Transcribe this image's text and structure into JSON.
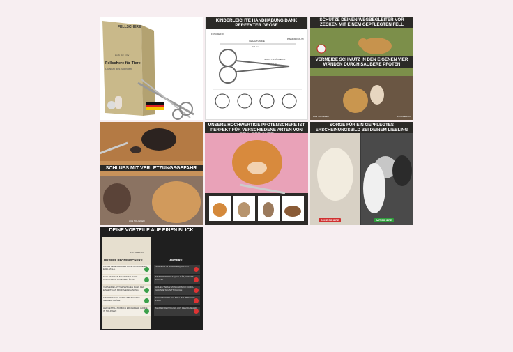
{
  "tile1": {
    "box_title": "FELLSCHERE",
    "brand": "FUTURE FOX",
    "line1": "Fellschere für Tiere",
    "line2": "Qualität aus Solingen"
  },
  "tile2": {
    "title": "KINDERLEICHTE HANDHABUNG DANK PERFEKTER GRÖßE",
    "brand": "FUTURE FOX",
    "length_label": "GESAMTLÄNGE",
    "length_value": "9,6 cm",
    "blade_label": "SCHNITTFLÄCHE CA.",
    "blade_value": "2,5 cm",
    "badge": "PREMIUM QUALITY"
  },
  "tile3": {
    "title": "SCHÜTZE DEINEN WEGBEGLEITER VOR ZECKEN MIT EINEM GEPFLEGTEN FELL",
    "subtitle": "VERMEIDE SCHMUTZ IN DEN EIGENEN VIER WÄNDEN DURCH SAUBERE PFOTEN",
    "footer_left": "AUS SOLINGEN",
    "footer_right": "FUTURE FOX"
  },
  "tile4": {
    "title": "SCHLUSS MIT VERLETZUNGSGEFAHR",
    "footer": "AUS SOLINGEN"
  },
  "tile5": {
    "title": "UNSERE HOCHWERTIGE PFOTENSCHERE IST PERFEKT FÜR VERSCHIEDENE ARTEN VON FELL GEEIGNET"
  },
  "tile6": {
    "title": "SORGE FÜR EIN GEPFLEGTES ERSCHEINUNGSBILD BEI DEINEM LIEBLING",
    "label_left": "OHNE SCHERE",
    "label_right": "MIT SCHERE"
  },
  "tile7": {
    "title": "DEINE VORTEILE AUF EINEN BLICK",
    "ours": "UNSERE PFOTENSCHERE",
    "others": "ANDERE",
    "brand": "FUTURE FOX",
    "ours_rows": [
      "LANGE LEBENSDAUER DANK ROSTFREIEM EDELSTAHL",
      "KEIN VERLETZUNGSRISIKO DANK GEBOGENER SCHNITTFLÄCHE",
      "VERMEIDE LÄSTIGES ZIEHEN DANK DER EINSEITIGEN MIKROVERZAHNUNG",
      "KINDERLEICHT HANDHABBAR DANK IDEALER GRÖßE",
      "HERGESTELLT DURCH ERFAHRENE HÄNDE IN SOLINGEN"
    ],
    "other_rows": [
      "SCHLECHTE SCHERENQUALITÄT",
      "MINDERWERTIGE QUALITÄT, ROSTET SCHNELL",
      "HOHES VERLETZUNGSRISIKO DURCH GERADE SCHNITTFLÄCHE",
      "SCHERE WIRD SCHNELL STUMPF UND ZIEHT",
      "MASSENFERTIGUNG AUS DEM AUSLAND"
    ]
  }
}
